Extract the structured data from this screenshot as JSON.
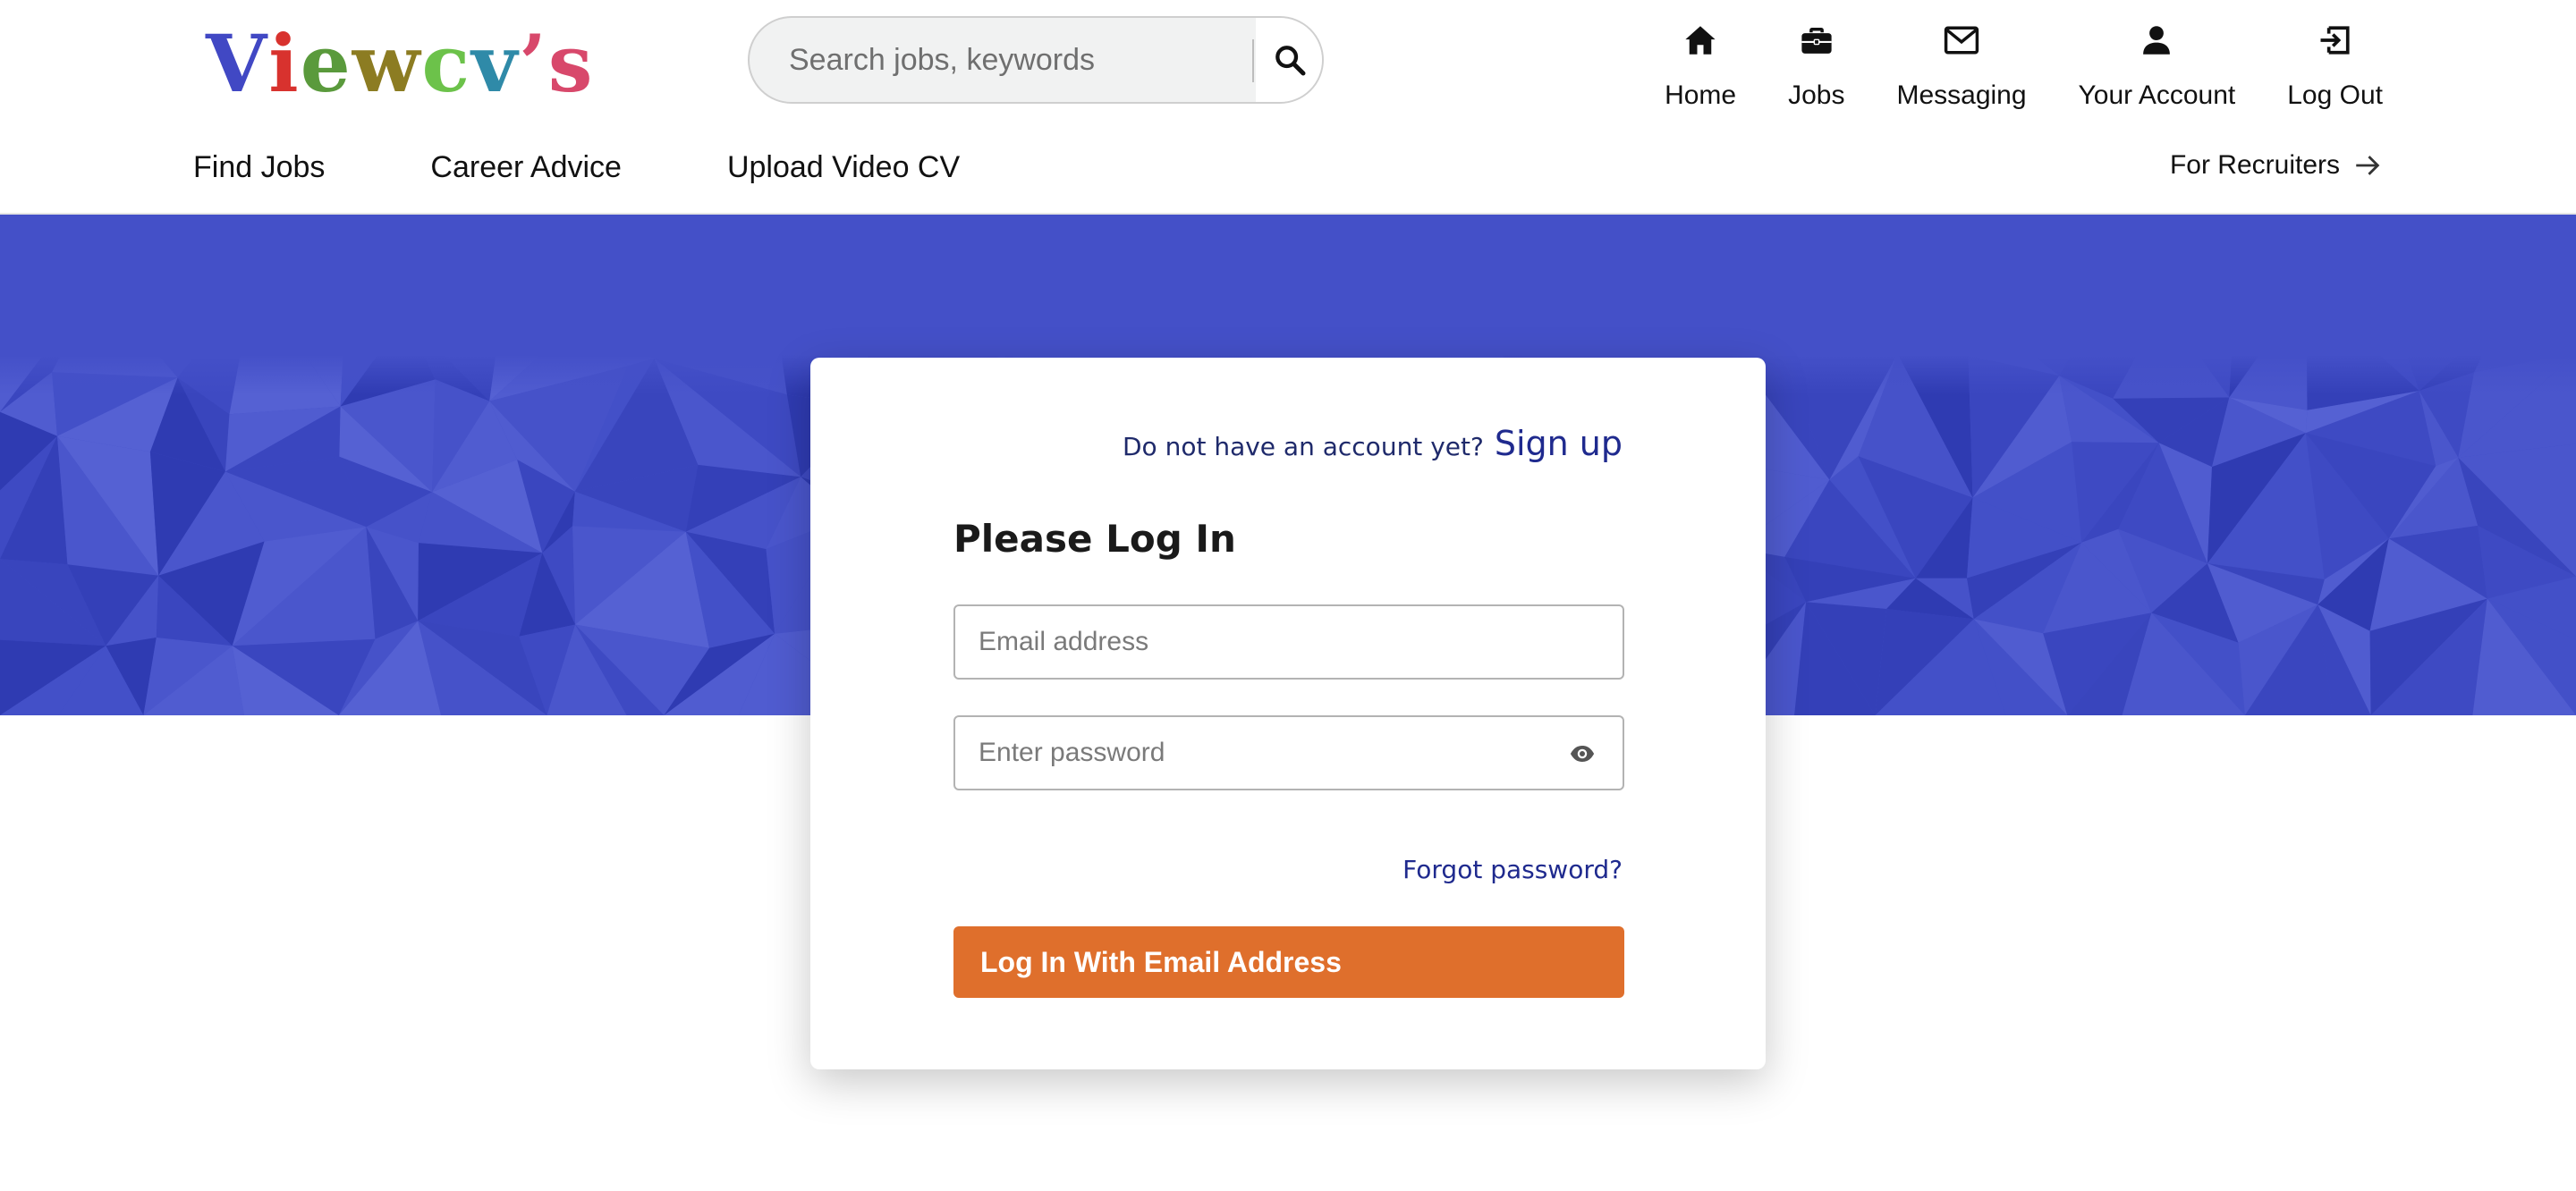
{
  "header": {
    "logo_letters": [
      {
        "char": "V",
        "color": "#4148c4"
      },
      {
        "char": "i",
        "color": "#d8322e"
      },
      {
        "char": "e",
        "color": "#5a9a3c"
      },
      {
        "char": "w",
        "color": "#8c7c22"
      },
      {
        "char": "c",
        "color": "#6cc24a"
      },
      {
        "char": "v",
        "color": "#2f8aa8"
      },
      {
        "char": "’",
        "color": "#d8486b"
      },
      {
        "char": "s",
        "color": "#d8486b"
      }
    ],
    "search": {
      "placeholder": "Search jobs, keywords",
      "icon": "search-icon"
    },
    "nav": [
      {
        "label": "Home",
        "icon": "home-icon"
      },
      {
        "label": "Jobs",
        "icon": "briefcase-icon"
      },
      {
        "label": "Messaging",
        "icon": "envelope-icon"
      },
      {
        "label": "Your Account",
        "icon": "user-icon"
      },
      {
        "label": "Log Out",
        "icon": "logout-icon"
      }
    ],
    "subnav": [
      "Find Jobs",
      "Career Advice",
      "Upload Video CV"
    ],
    "recruiters": {
      "label": "For Recruiters",
      "icon": "arrow-right-icon"
    }
  },
  "colors": {
    "banner": "#424fc7",
    "accent_button": "#df6f2c",
    "link": "#1f2a8e"
  },
  "login": {
    "signup_prompt": "Do not have an account yet?",
    "signup_link": "Sign up",
    "title": "Please Log In",
    "email_placeholder": "Email address",
    "password_placeholder": "Enter password",
    "password_toggle_icon": "eye-icon",
    "forgot": "Forgot password?",
    "submit": "Log In With Email Address"
  }
}
